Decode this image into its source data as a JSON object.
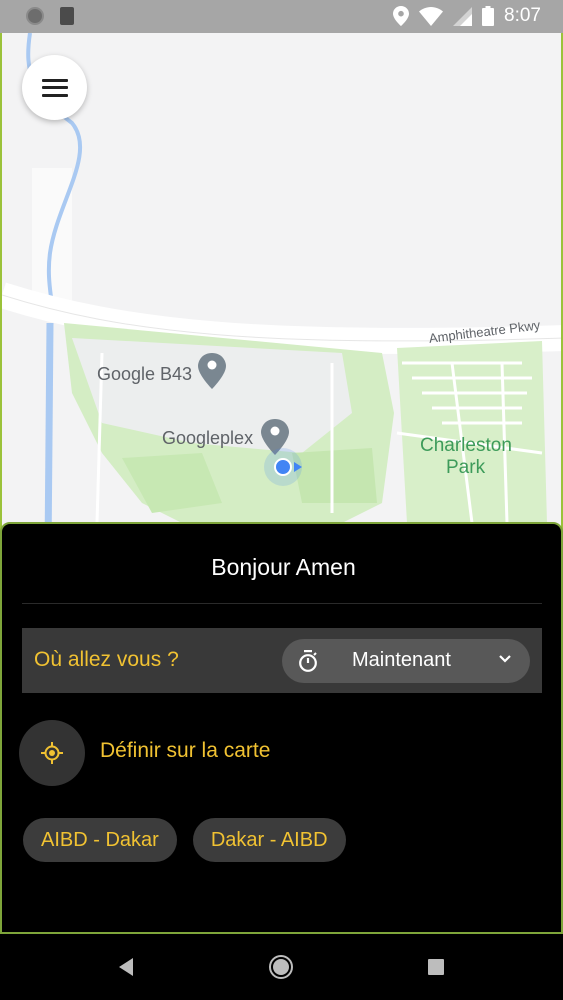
{
  "status_bar": {
    "time": "8:07",
    "icons": [
      "circle-icon",
      "sd-card-icon",
      "location-icon",
      "wifi-icon",
      "signal-icon",
      "battery-icon"
    ]
  },
  "map": {
    "labels": {
      "google_b43": "Google B43",
      "googleplex": "Googleplex",
      "charleston_line1": "Charleston",
      "charleston_line2": "Park",
      "amphitheatre": "Amphitheatre Pkwy"
    },
    "menu_icon": "hamburger-menu-icon"
  },
  "sheet": {
    "greeting": "Bonjour Amen",
    "where_label": "Où allez vous ?",
    "time_selector": {
      "value": "Maintenant",
      "icon": "timer-icon",
      "chevron": "chevron-down-icon"
    },
    "set_on_map": {
      "label": "Définir sur la carte",
      "icon": "gps-target-icon"
    },
    "shortcuts": [
      "AIBD - Dakar",
      "Dakar - AIBD"
    ]
  },
  "colors": {
    "accent": "#f1c232",
    "sheet_bg": "#000000",
    "bar_bg": "#393939",
    "pill_bg": "#585858",
    "location_dot": "#4285f4"
  },
  "nav_bar": {
    "icons": [
      "back-icon",
      "home-icon",
      "recent-apps-icon"
    ]
  }
}
